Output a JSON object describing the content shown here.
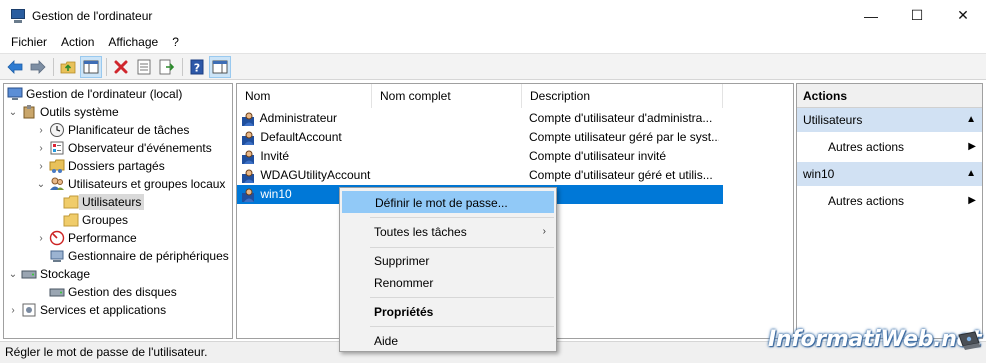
{
  "window": {
    "title": "Gestion de l'ordinateur",
    "controls": [
      "—",
      "☐",
      "✕"
    ]
  },
  "menubar": [
    "Fichier",
    "Action",
    "Affichage",
    "?"
  ],
  "toolbar": {
    "buttons": [
      "back-icon",
      "forward-icon",
      "up-folder-icon",
      "show-hide-tree-icon",
      "delete-icon",
      "properties-icon",
      "export-icon",
      "help-icon",
      "show-hide-action-pane-icon"
    ]
  },
  "tree": {
    "root": "Gestion de l'ordinateur (local)",
    "outils": "Outils système",
    "planificateur": "Planificateur de tâches",
    "observateur": "Observateur d'événements",
    "dossiers": "Dossiers partagés",
    "utilisateurs_groupes": "Utilisateurs et groupes locaux",
    "utilisateurs": "Utilisateurs",
    "groupes": "Groupes",
    "performance": "Performance",
    "gestionnaire": "Gestionnaire de périphériques",
    "stockage": "Stockage",
    "disques": "Gestion des disques",
    "services": "Services et applications"
  },
  "list": {
    "columns": [
      "Nom",
      "Nom complet",
      "Description"
    ],
    "rows": [
      {
        "name": "Administrateur",
        "fullname": "",
        "description": "Compte d'utilisateur d'administra..."
      },
      {
        "name": "DefaultAccount",
        "fullname": "",
        "description": "Compte utilisateur géré par le syst..."
      },
      {
        "name": "Invité",
        "fullname": "",
        "description": "Compte d'utilisateur invité"
      },
      {
        "name": "WDAGUtilityAccount",
        "fullname": "",
        "description": "Compte d'utilisateur géré et utilis..."
      },
      {
        "name": "win10",
        "fullname": "",
        "description": ""
      }
    ]
  },
  "actions": {
    "header": "Actions",
    "section1": "Utilisateurs",
    "section1_item": "Autres actions",
    "section2": "win10",
    "section2_item": "Autres actions"
  },
  "context_menu": {
    "set_password": "Définir le mot de passe...",
    "all_tasks": "Toutes les tâches",
    "delete": "Supprimer",
    "rename": "Renommer",
    "properties": "Propriétés",
    "help": "Aide"
  },
  "status": "Régler le mot de passe de l'utilisateur.",
  "watermark": "InformatiWeb.net",
  "colors": {
    "selection": "#0078d7",
    "section_bg": "#d1e1f3",
    "menu_hover": "#91c9f7"
  }
}
